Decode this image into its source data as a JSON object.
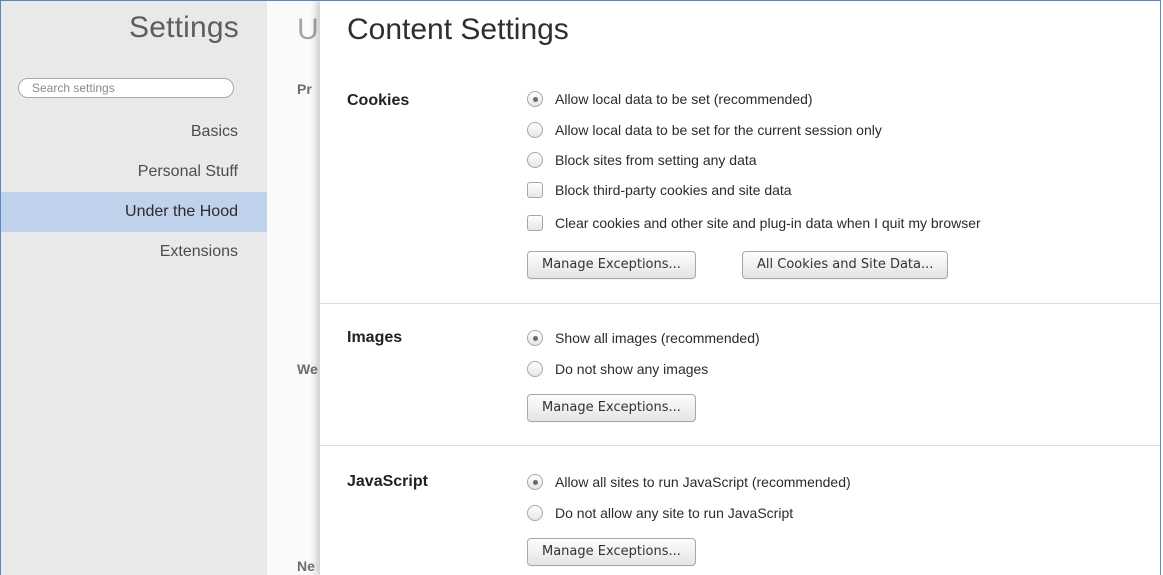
{
  "sidebar": {
    "title": "Settings",
    "search_placeholder": "Search settings",
    "items": [
      {
        "label": "Basics",
        "selected": false
      },
      {
        "label": "Personal Stuff",
        "selected": false
      },
      {
        "label": "Under the Hood",
        "selected": true
      },
      {
        "label": "Extensions",
        "selected": false
      }
    ]
  },
  "background_page": {
    "title_fragment": "U",
    "label_1": "Pr",
    "label_2": "We",
    "label_3": "Ne"
  },
  "content_settings": {
    "title": "Content Settings",
    "cookies": {
      "label": "Cookies",
      "options": [
        {
          "type": "radio",
          "label": "Allow local data to be set (recommended)",
          "checked": true
        },
        {
          "type": "radio",
          "label": "Allow local data to be set for the current session only",
          "checked": false
        },
        {
          "type": "radio",
          "label": "Block sites from setting any data",
          "checked": false
        },
        {
          "type": "checkbox",
          "label": "Block third-party cookies and site data",
          "checked": false
        },
        {
          "type": "checkbox",
          "label": "Clear cookies and other site and plug-in data when I quit my browser",
          "checked": false
        }
      ],
      "buttons": [
        "Manage Exceptions...",
        "All Cookies and Site Data..."
      ]
    },
    "images": {
      "label": "Images",
      "options": [
        {
          "type": "radio",
          "label": "Show all images (recommended)",
          "checked": true
        },
        {
          "type": "radio",
          "label": "Do not show any images",
          "checked": false
        }
      ],
      "buttons": [
        "Manage Exceptions..."
      ]
    },
    "javascript": {
      "label": "JavaScript",
      "options": [
        {
          "type": "radio",
          "label": "Allow all sites to run JavaScript (recommended)",
          "checked": true
        },
        {
          "type": "radio",
          "label": "Do not allow any site to run JavaScript",
          "checked": false
        }
      ],
      "buttons": [
        "Manage Exceptions..."
      ]
    }
  },
  "colors": {
    "sidebar_bg": "#e9e9e9",
    "selected_bg": "#bfd1eb",
    "frame_border": "#5a86c8"
  }
}
